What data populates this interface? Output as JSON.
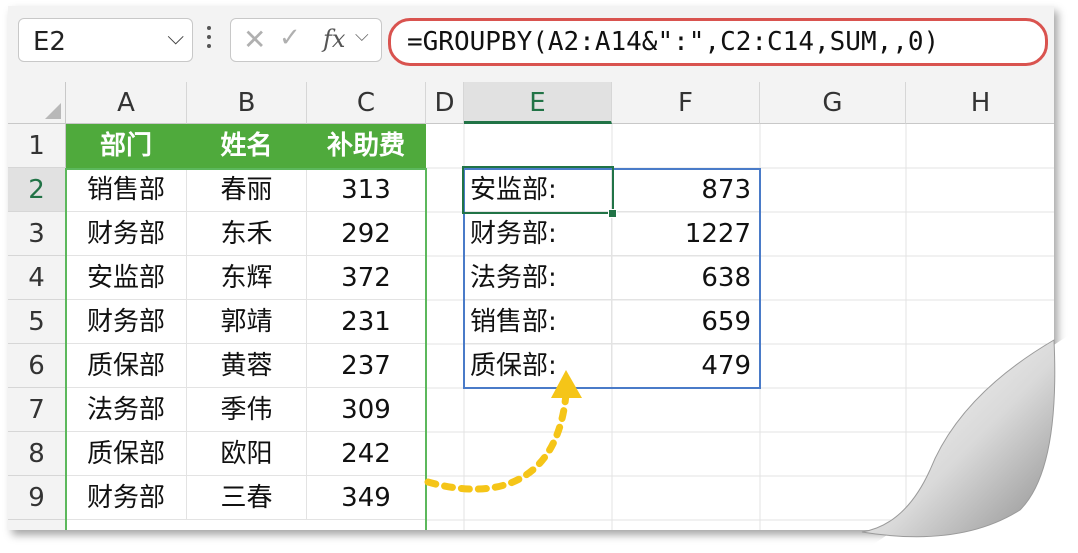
{
  "formula_bar": {
    "name_box": "E2",
    "formula": "=GROUPBY(A2:A14&\":\",C2:C14,SUM,,0)",
    "fx_label": "fx"
  },
  "columns": [
    "A",
    "B",
    "C",
    "D",
    "E",
    "F",
    "G",
    "H"
  ],
  "rows": [
    "1",
    "2",
    "3",
    "4",
    "5",
    "6",
    "7",
    "8",
    "9"
  ],
  "source_table": {
    "headers": [
      "部门",
      "姓名",
      "补助费"
    ],
    "rows": [
      [
        "销售部",
        "春丽",
        "313"
      ],
      [
        "财务部",
        "东禾",
        "292"
      ],
      [
        "安监部",
        "东辉",
        "372"
      ],
      [
        "财务部",
        "郭靖",
        "231"
      ],
      [
        "质保部",
        "黄蓉",
        "237"
      ],
      [
        "法务部",
        "季伟",
        "309"
      ],
      [
        "质保部",
        "欧阳",
        "242"
      ],
      [
        "财务部",
        "三春",
        "349"
      ]
    ]
  },
  "result_table": {
    "rows": [
      [
        "安监部:",
        "873"
      ],
      [
        "财务部:",
        "1227"
      ],
      [
        "法务部:",
        "638"
      ],
      [
        "销售部:",
        "659"
      ],
      [
        "质保部:",
        "479"
      ]
    ]
  },
  "colors": {
    "header_green": "#4faa3c",
    "accent_red": "#d9534f",
    "arrow_yellow": "#f5c518",
    "selection": "#217346"
  }
}
